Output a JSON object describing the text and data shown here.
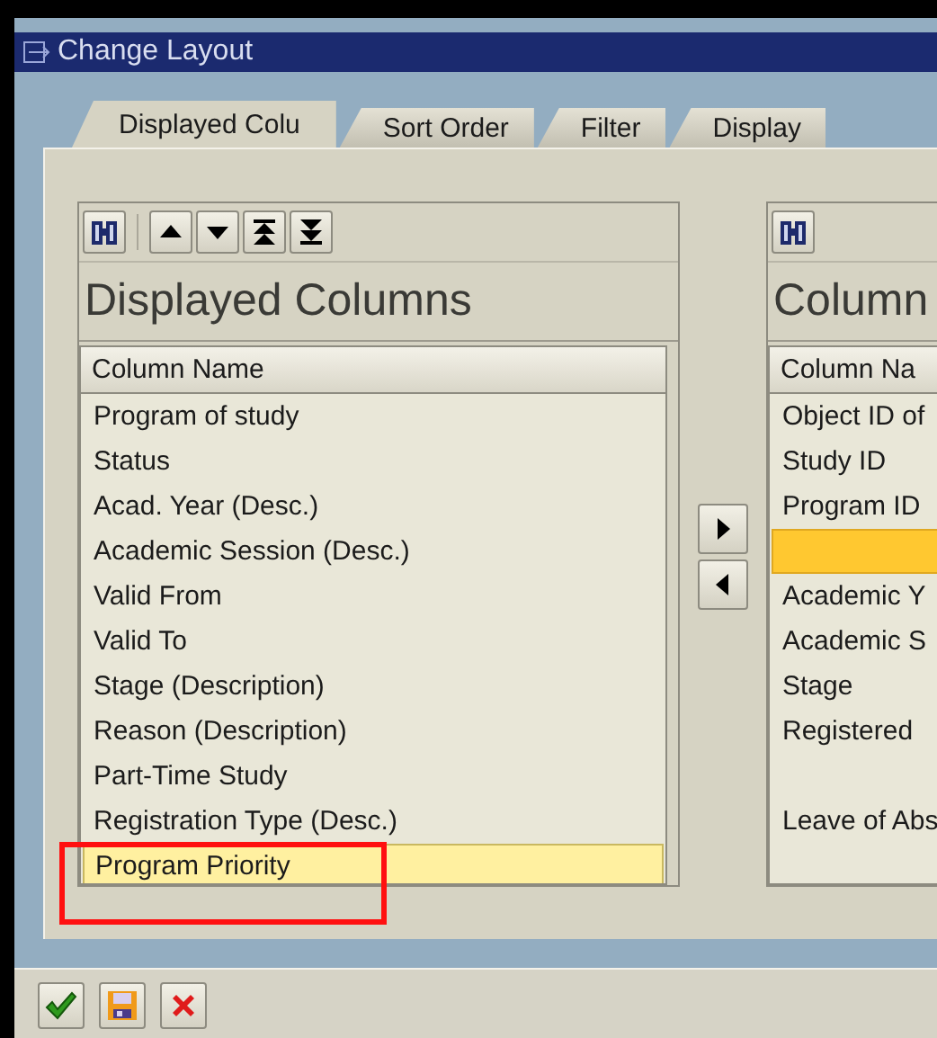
{
  "window": {
    "title": "Change Layout"
  },
  "tabs": [
    {
      "label": "Displayed Colu",
      "selected": true
    },
    {
      "label": "Sort Order",
      "selected": false
    },
    {
      "label": "Filter",
      "selected": false
    },
    {
      "label": "Display",
      "selected": false
    }
  ],
  "displayed_columns": {
    "title": "Displayed Columns",
    "header": "Column Name",
    "rows": [
      {
        "label": "Program of study",
        "selected": false
      },
      {
        "label": "Status",
        "selected": false
      },
      {
        "label": "Acad. Year (Desc.)",
        "selected": false
      },
      {
        "label": "Academic Session (Desc.)",
        "selected": false
      },
      {
        "label": "Valid From",
        "selected": false
      },
      {
        "label": "Valid To",
        "selected": false
      },
      {
        "label": "Stage (Description)",
        "selected": false
      },
      {
        "label": "Reason (Description)",
        "selected": false
      },
      {
        "label": "Part-Time Study",
        "selected": false
      },
      {
        "label": "Registration Type (Desc.)",
        "selected": false
      },
      {
        "label": "Program Priority",
        "selected": true
      }
    ]
  },
  "column_set": {
    "title": "Column",
    "header": "Column Na",
    "rows": [
      {
        "label": "Object ID of",
        "selected": false
      },
      {
        "label": "Study ID",
        "selected": false
      },
      {
        "label": "Program ID",
        "selected": false
      },
      {
        "selected": true
      },
      {
        "label": "Academic Y",
        "selected": false
      },
      {
        "label": "Academic S",
        "selected": false
      },
      {
        "label": "Stage",
        "selected": false
      },
      {
        "label": "Registered",
        "selected": false
      },
      {
        "selected": false
      },
      {
        "label": "Leave of Abs",
        "selected": false
      }
    ]
  }
}
